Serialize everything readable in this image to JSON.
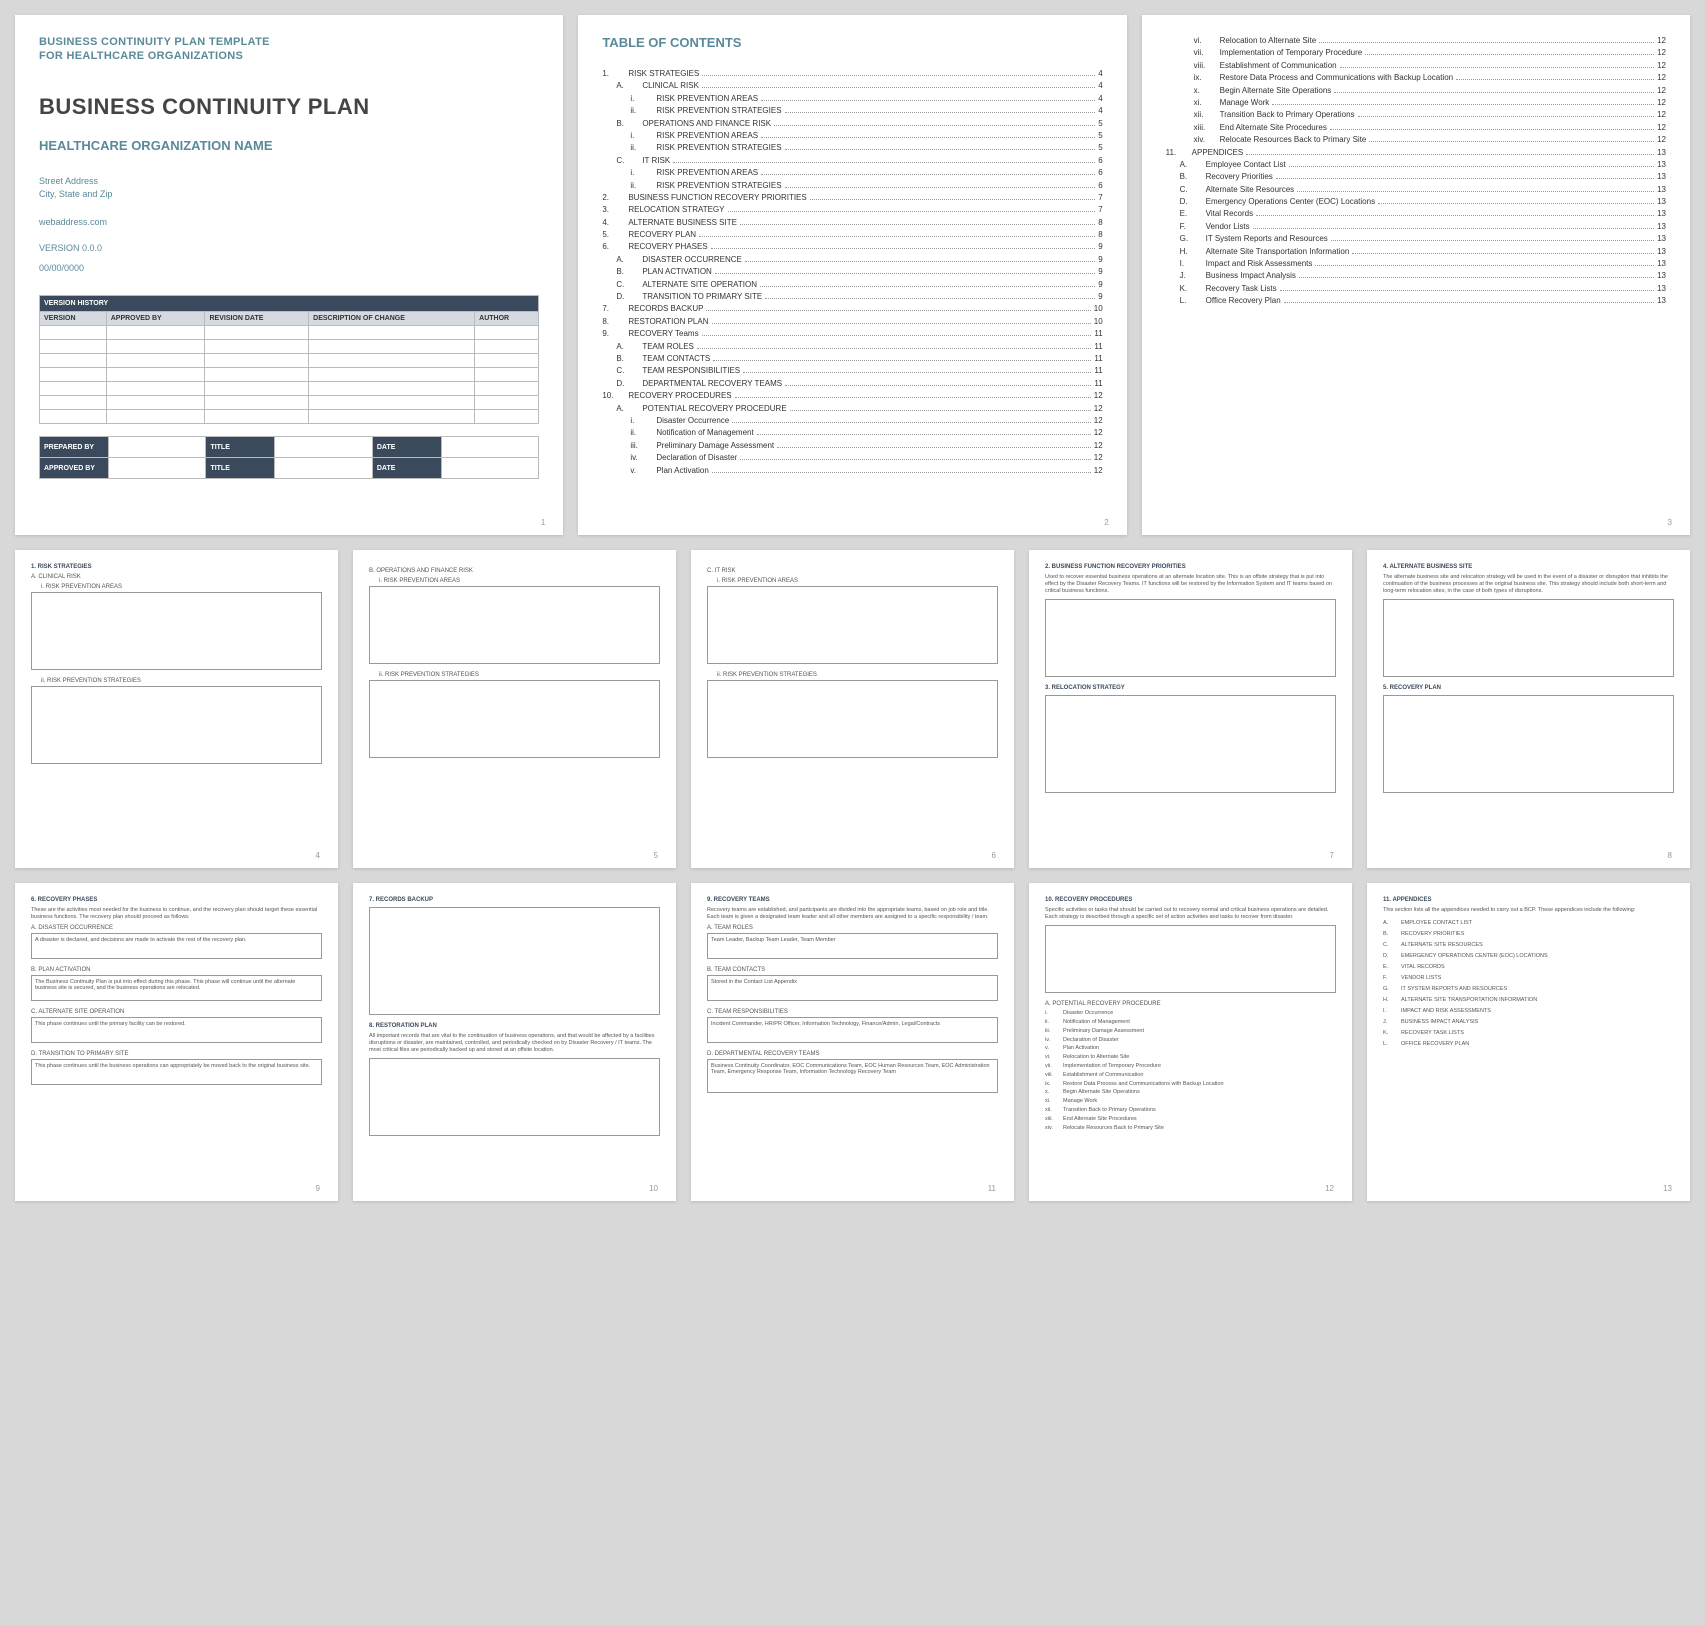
{
  "p1": {
    "tmpl1": "BUSINESS CONTINUITY PLAN TEMPLATE",
    "tmpl2": "FOR HEALTHCARE ORGANIZATIONS",
    "title": "BUSINESS CONTINUITY PLAN",
    "org": "HEALTHCARE ORGANIZATION NAME",
    "addr1": "Street Address",
    "addr2": "City, State and Zip",
    "web": "webaddress.com",
    "ver": "VERSION 0.0.0",
    "date": "00/00/0000",
    "vh": "VERSION HISTORY",
    "cols": [
      "VERSION",
      "APPROVED BY",
      "REVISION DATE",
      "DESCRIPTION OF CHANGE",
      "AUTHOR"
    ],
    "sig": {
      "prep": "PREPARED BY",
      "appr": "APPROVED BY",
      "title": "TITLE",
      "date": "DATE"
    }
  },
  "p2": {
    "hdr": "TABLE OF CONTENTS",
    "items": [
      {
        "n": "1.",
        "t": "RISK STRATEGIES",
        "p": "4",
        "i": 0
      },
      {
        "n": "A.",
        "t": "CLINICAL RISK",
        "p": "4",
        "i": 1
      },
      {
        "n": "i.",
        "t": "RISK PREVENTION AREAS",
        "p": "4",
        "i": 2
      },
      {
        "n": "ii.",
        "t": "RISK PREVENTION STRATEGIES",
        "p": "4",
        "i": 2
      },
      {
        "n": "B.",
        "t": "OPERATIONS AND FINANCE RISK",
        "p": "5",
        "i": 1
      },
      {
        "n": "i.",
        "t": "RISK PREVENTION AREAS",
        "p": "5",
        "i": 2
      },
      {
        "n": "ii.",
        "t": "RISK PREVENTION STRATEGIES",
        "p": "5",
        "i": 2
      },
      {
        "n": "C.",
        "t": "IT RISK",
        "p": "6",
        "i": 1
      },
      {
        "n": "i.",
        "t": "RISK PREVENTION AREAS",
        "p": "6",
        "i": 2
      },
      {
        "n": "ii.",
        "t": "RISK PREVENTION STRATEGIES",
        "p": "6",
        "i": 2
      },
      {
        "n": "2.",
        "t": "BUSINESS FUNCTION RECOVERY PRIORITIES",
        "p": "7",
        "i": 0
      },
      {
        "n": "3.",
        "t": "RELOCATION STRATEGY",
        "p": "7",
        "i": 0
      },
      {
        "n": "4.",
        "t": "ALTERNATE BUSINESS SITE",
        "p": "8",
        "i": 0
      },
      {
        "n": "5.",
        "t": "RECOVERY PLAN",
        "p": "8",
        "i": 0
      },
      {
        "n": "6.",
        "t": "RECOVERY PHASES",
        "p": "9",
        "i": 0
      },
      {
        "n": "A.",
        "t": "DISASTER OCCURRENCE",
        "p": "9",
        "i": 1
      },
      {
        "n": "B.",
        "t": "PLAN ACTIVATION",
        "p": "9",
        "i": 1
      },
      {
        "n": "C.",
        "t": "ALTERNATE SITE OPERATION",
        "p": "9",
        "i": 1
      },
      {
        "n": "D.",
        "t": "TRANSITION TO PRIMARY SITE",
        "p": "9",
        "i": 1
      },
      {
        "n": "7.",
        "t": "RECORDS BACKUP",
        "p": "10",
        "i": 0
      },
      {
        "n": "8.",
        "t": "RESTORATION PLAN",
        "p": "10",
        "i": 0
      },
      {
        "n": "9.",
        "t": "RECOVERY Teams",
        "p": "11",
        "i": 0
      },
      {
        "n": "A.",
        "t": "TEAM ROLES",
        "p": "11",
        "i": 1
      },
      {
        "n": "B.",
        "t": "TEAM CONTACTS",
        "p": "11",
        "i": 1
      },
      {
        "n": "C.",
        "t": "TEAM RESPONSIBILITIES",
        "p": "11",
        "i": 1
      },
      {
        "n": "D.",
        "t": "DEPARTMENTAL RECOVERY TEAMS",
        "p": "11",
        "i": 1
      },
      {
        "n": "10.",
        "t": "RECOVERY PROCEDURES",
        "p": "12",
        "i": 0
      },
      {
        "n": "A.",
        "t": "POTENTIAL RECOVERY PROCEDURE",
        "p": "12",
        "i": 1
      },
      {
        "n": "i.",
        "t": "Disaster Occurrence",
        "p": "12",
        "i": 2
      },
      {
        "n": "ii.",
        "t": "Notification of Management",
        "p": "12",
        "i": 2
      },
      {
        "n": "iii.",
        "t": "Preliminary Damage Assessment",
        "p": "12",
        "i": 2
      },
      {
        "n": "iv.",
        "t": "Declaration of Disaster",
        "p": "12",
        "i": 2
      },
      {
        "n": "v.",
        "t": "Plan Activation",
        "p": "12",
        "i": 2
      }
    ]
  },
  "p3": {
    "items": [
      {
        "n": "vi.",
        "t": "Relocation to Alternate Site",
        "p": "12",
        "i": 2
      },
      {
        "n": "vii.",
        "t": "Implementation of Temporary Procedure",
        "p": "12",
        "i": 2
      },
      {
        "n": "viii.",
        "t": "Establishment of Communication",
        "p": "12",
        "i": 2
      },
      {
        "n": "ix.",
        "t": "Restore Data Process and Communications with Backup Location",
        "p": "12",
        "i": 2
      },
      {
        "n": "x.",
        "t": "Begin Alternate Site Operations",
        "p": "12",
        "i": 2
      },
      {
        "n": "xi.",
        "t": "Manage Work",
        "p": "12",
        "i": 2
      },
      {
        "n": "xii.",
        "t": "Transition Back to Primary Operations",
        "p": "12",
        "i": 2
      },
      {
        "n": "xiii.",
        "t": "End Alternate Site Procedures",
        "p": "12",
        "i": 2
      },
      {
        "n": "xiv.",
        "t": "Relocate Resources Back to Primary Site",
        "p": "12",
        "i": 2
      },
      {
        "n": "11.",
        "t": "APPENDICES",
        "p": "13",
        "i": 0
      },
      {
        "n": "A.",
        "t": "Employee Contact List",
        "p": "13",
        "i": 1
      },
      {
        "n": "B.",
        "t": "Recovery Priorities",
        "p": "13",
        "i": 1
      },
      {
        "n": "C.",
        "t": "Alternate Site Resources",
        "p": "13",
        "i": 1
      },
      {
        "n": "D.",
        "t": "Emergency Operations Center (EOC) Locations",
        "p": "13",
        "i": 1
      },
      {
        "n": "E.",
        "t": "Vital Records",
        "p": "13",
        "i": 1
      },
      {
        "n": "F.",
        "t": "Vendor Lists",
        "p": "13",
        "i": 1
      },
      {
        "n": "G.",
        "t": "IT System Reports and Resources",
        "p": "13",
        "i": 1
      },
      {
        "n": "H.",
        "t": "Alternate Site Transportation Information",
        "p": "13",
        "i": 1
      },
      {
        "n": "I.",
        "t": "Impact and Risk Assessments",
        "p": "13",
        "i": 1
      },
      {
        "n": "J.",
        "t": "Business Impact Analysis",
        "p": "13",
        "i": 1
      },
      {
        "n": "K.",
        "t": "Recovery Task Lists",
        "p": "13",
        "i": 1
      },
      {
        "n": "L.",
        "t": "Office Recovery Plan",
        "p": "13",
        "i": 1
      }
    ]
  },
  "p4": {
    "h": "1. RISK STRATEGIES",
    "a": "A. CLINICAL RISK",
    "s1": "i.   RISK PREVENTION AREAS",
    "s2": "ii.   RISK PREVENTION STRATEGIES"
  },
  "p5": {
    "a": "B. OPERATIONS AND FINANCE RISK",
    "s1": "i.   RISK PREVENTION AREAS",
    "s2": "ii.   RISK PREVENTION STRATEGIES"
  },
  "p6": {
    "a": "C. IT RISK",
    "s1": "i.   RISK PREVENTION AREAS",
    "s2": "ii.   RISK PREVENTION STRATEGIES"
  },
  "p7": {
    "h1": "2.  BUSINESS FUNCTION RECOVERY PRIORITIES",
    "d1": "Used to recover essential business operations at an alternate location site. This is an offsite strategy that is put into effect by the Disaster Recovery Teams. IT functions will be restored by the Information System and IT teams based on critical business functions.",
    "h2": "3.  RELOCATION STRATEGY"
  },
  "p8": {
    "h1": "4.  ALTERNATE BUSINESS SITE",
    "d1": "The alternate business site and relocation strategy will be used in the event of a disaster or disruption that inhibits the continuation of the business processes at the original business site. This strategy should include both short-term and long-term relocation sites, in the case of both types of disruptions.",
    "h2": "5.  RECOVERY PLAN"
  },
  "p9": {
    "h": "6.  RECOVERY PHASES",
    "d": "These are the activities most needed for the business to continue, and the recovery plan should target these essential business functions. The recovery plan should proceed as follows:",
    "a": "A. DISASTER OCCURRENCE",
    "at": "A disaster is declared, and decisions are made to activate the rest of the recovery plan.",
    "b": "B. PLAN ACTIVATION",
    "bt": "The Business Continuity Plan is put into effect during this phase. This phase will continue until the alternate business site is secured, and the business operations are relocated.",
    "c": "C. ALTERNATE SITE OPERATION",
    "ct": "This phase continues until the primary facility can be restored.",
    "dN": "D. TRANSITION TO PRIMARY SITE",
    "dt": "This phase continues until the business operations can appropriately be moved back to the original business site."
  },
  "p10": {
    "h1": "7.  RECORDS BACKUP",
    "h2": "8.  RESTORATION PLAN",
    "d2": "All important records that are vital to the continuation of business operations, and that would be affected by a facilities disruptions or disaster, are maintained, controlled, and periodically checked on by Disaster Recovery / IT teams. The most critical files are periodically backed up and stored at an offsite location."
  },
  "p11": {
    "h": "9.  RECOVERY TEAMS",
    "d": "Recovery teams are established, and participants are divided into the appropriate teams, based on job role and title. Each team is given a designated team leader and all other members are assigned to a specific responsibility / team.",
    "a": "A. TEAM ROLES",
    "at": "Team Leader, Backup Team Leader, Team Member",
    "b": "B. TEAM CONTACTS",
    "bt": "Stored in the Contact List Appendix",
    "c": "C. TEAM RESPONSIBILITIES",
    "ct": "Incident Commander, HR/PR Officer, Information Technology, Finance/Admin, Legal/Contracts",
    "dN": "D. DEPARTMENTAL RECOVERY TEAMS",
    "dt": "Business Continuity Coordinator, EOC Communications Team, EOC Human Resources Team, EOC Administration Team, Emergency Response Team, Information Technology Recovery Team"
  },
  "p12": {
    "h": "10.   RECOVERY PROCEDURES",
    "d": "Specific activities or tasks that should be carried out to recovery normal and critical business operations are detailed. Each strategy is described through a specific set of action activities and tasks to recover from disaster.",
    "a": "A. POTENTIAL RECOVERY PROCEDURE",
    "items": [
      {
        "n": "i.",
        "t": "Disaster Occurrence"
      },
      {
        "n": "ii.",
        "t": "Notification of Management"
      },
      {
        "n": "iii.",
        "t": "Preliminary Damage Assessment"
      },
      {
        "n": "iv.",
        "t": "Declaration of Disaster"
      },
      {
        "n": "v.",
        "t": "Plan Activation"
      },
      {
        "n": "vi.",
        "t": "Relocation to Alternate Site"
      },
      {
        "n": "vii.",
        "t": "Implementation of Temporary Procedure"
      },
      {
        "n": "viii.",
        "t": "Establishment of Communication"
      },
      {
        "n": "ix.",
        "t": "Restore Data Process and Communications with Backup Location"
      },
      {
        "n": "x.",
        "t": "Begin Alternate Site Operations"
      },
      {
        "n": "xi.",
        "t": "Manage Work"
      },
      {
        "n": "xii.",
        "t": "Transition Back to Primary Operations"
      },
      {
        "n": "xiii.",
        "t": "End Alternate Site Procedures"
      },
      {
        "n": "xiv.",
        "t": "Relocate Resources Back to Primary Site"
      }
    ]
  },
  "p13": {
    "h": "11.   APPENDICES",
    "d": "This section lists all the appendices needed to carry out a BCP. These appendices include the following:",
    "items": [
      {
        "n": "A.",
        "t": "EMPLOYEE CONTACT LIST"
      },
      {
        "n": "B.",
        "t": "RECOVERY PRIORITIES"
      },
      {
        "n": "C.",
        "t": "ALTERNATE SITE RESOURCES"
      },
      {
        "n": "D.",
        "t": "EMERGENCY OPERATIONS CENTER (EOC) LOCATIONS"
      },
      {
        "n": "E.",
        "t": "VITAL RECORDS"
      },
      {
        "n": "F.",
        "t": "VENDOR LISTS"
      },
      {
        "n": "G.",
        "t": "IT SYSTEM REPORTS AND RESOURCES"
      },
      {
        "n": "H.",
        "t": "ALTERNATE SITE TRANSPORTATION INFORMATION"
      },
      {
        "n": "I.",
        "t": "IMPACT AND RISK ASSESSMENTS"
      },
      {
        "n": "J.",
        "t": "BUSINESS IMPACT ANALYSIS"
      },
      {
        "n": "K.",
        "t": "RECOVERY TASK LISTS"
      },
      {
        "n": "L.",
        "t": "OFFICE RECOVERY PLAN"
      }
    ]
  }
}
